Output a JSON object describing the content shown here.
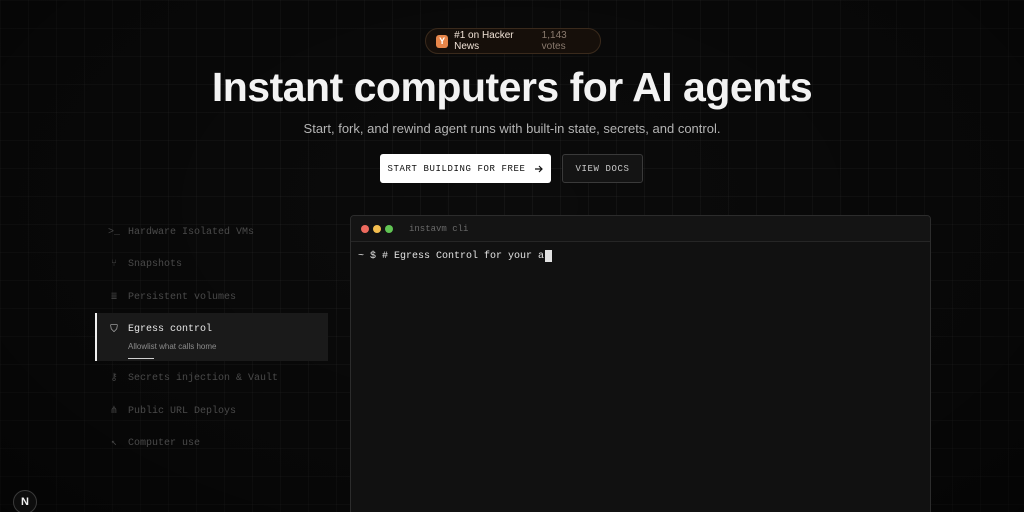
{
  "badge": {
    "icon_letter": "Y",
    "title": "#1 on Hacker News",
    "votes": "1,143 votes"
  },
  "hero": {
    "title": "Instant computers for AI agents",
    "subtitle": "Start, fork, and rewind agent runs with built-in state, secrets, and control."
  },
  "cta": {
    "primary_label": "START BUILDING FOR FREE",
    "primary_icon": "arrow-right-icon",
    "secondary_label": "VIEW DOCS"
  },
  "features": {
    "items": [
      {
        "label": "Hardware Isolated VMs",
        "icon": "terminal-icon",
        "glyph": ">_"
      },
      {
        "label": "Snapshots",
        "icon": "fork-icon",
        "glyph": "⑂"
      },
      {
        "label": "Persistent volumes",
        "icon": "database-icon",
        "glyph": "≣"
      },
      {
        "label": "Egress control",
        "icon": "shield-icon",
        "glyph": "⛉",
        "description": "Allowlist what calls home",
        "active": true
      },
      {
        "label": "Secrets injection & Vault",
        "icon": "key-icon",
        "glyph": "⚷"
      },
      {
        "label": "Public URL Deploys",
        "icon": "share-icon",
        "glyph": "⋔"
      },
      {
        "label": "Computer use",
        "icon": "pointer-icon",
        "glyph": "↖"
      }
    ]
  },
  "terminal": {
    "title": "instavm cli",
    "prompt": "~ $",
    "command": "# Egress Control for your a",
    "dots": [
      "#ed6a5e",
      "#f4be4f",
      "#61c554"
    ]
  },
  "floating": {
    "label": "N"
  },
  "colors": {
    "background": "#0b0b0b",
    "accent": "#e8864a",
    "primary_button": "#ffffff"
  }
}
